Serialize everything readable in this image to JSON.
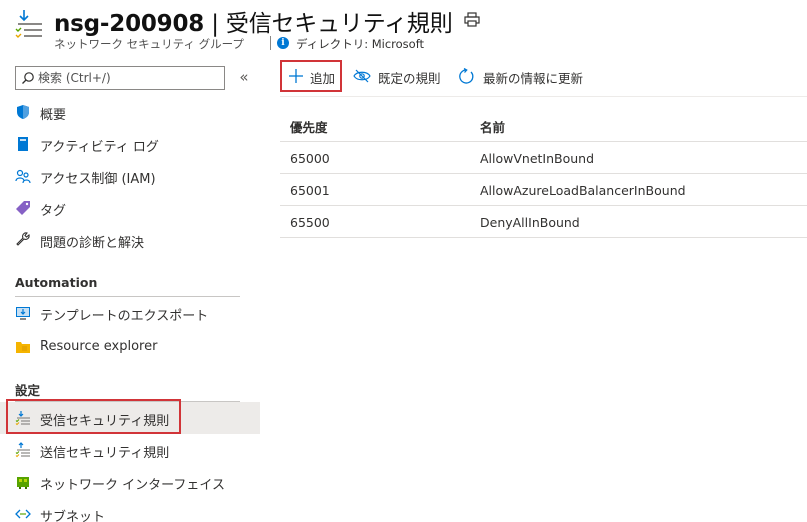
{
  "header": {
    "resource_name": "nsg-200908",
    "title_separator": " | ",
    "page_name": "受信セキュリティ規則",
    "resource_type": "ネットワーク セキュリティ グループ",
    "directory": "ディレクトリ: Microsoft",
    "print_icon": "print-icon",
    "info_icon": "info-icon"
  },
  "sidebar": {
    "search_placeholder": "検索 (Ctrl+/)",
    "collapse_label": "«",
    "items": [
      {
        "label": "概要",
        "icon": "shield-icon"
      },
      {
        "label": "アクティビティ ログ",
        "icon": "log-icon"
      },
      {
        "label": "アクセス制御 (IAM)",
        "icon": "people-icon"
      },
      {
        "label": "タグ",
        "icon": "tag-icon"
      },
      {
        "label": "問題の診断と解決",
        "icon": "wrench-icon"
      }
    ],
    "section_automation": "Automation",
    "automation_items": [
      {
        "label": "テンプレートのエクスポート",
        "icon": "export-icon"
      },
      {
        "label": "Resource explorer",
        "icon": "folder-icon"
      }
    ],
    "section_settings": "設定",
    "settings_items": [
      {
        "label": "受信セキュリティ規則",
        "icon": "inbound-rules-icon",
        "active": true
      },
      {
        "label": "送信セキュリティ規則",
        "icon": "outbound-rules-icon"
      },
      {
        "label": "ネットワーク インターフェイス",
        "icon": "nic-icon"
      },
      {
        "label": "サブネット",
        "icon": "subnet-icon"
      }
    ]
  },
  "toolbar": {
    "add_label": "追加",
    "default_rules_label": "既定の規則",
    "refresh_label": "最新の情報に更新"
  },
  "table": {
    "columns": [
      "優先度",
      "名前"
    ],
    "rows": [
      [
        "65000",
        "AllowVnetInBound"
      ],
      [
        "65001",
        "AllowAzureLoadBalancerInBound"
      ],
      [
        "65500",
        "DenyAllInBound"
      ]
    ]
  },
  "colors": {
    "accent": "#0078d4",
    "highlight": "#d13438",
    "active_bg": "#edebe9"
  }
}
